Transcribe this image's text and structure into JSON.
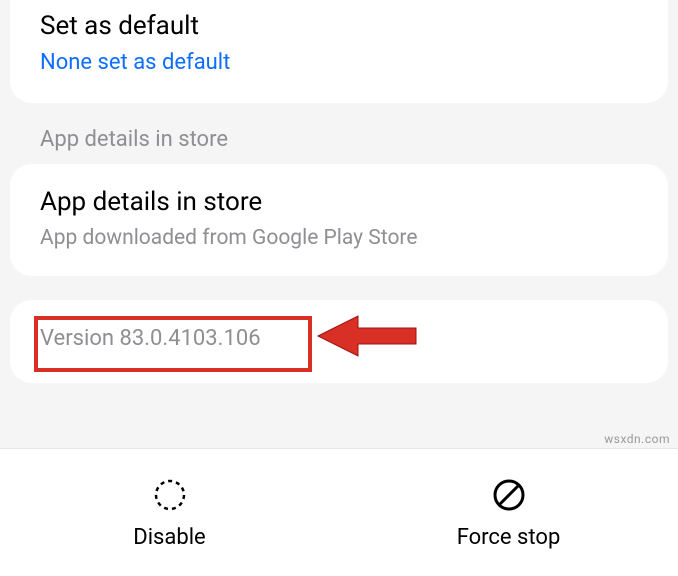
{
  "defaultSection": {
    "title": "Set as default",
    "subtitle": "None set as default"
  },
  "storeHeader": "App details in store",
  "storeSection": {
    "title": "App details in store",
    "subtitle": "App downloaded from Google Play Store"
  },
  "versionSection": {
    "text": "Version 83.0.4103.106"
  },
  "bottomBar": {
    "disable": "Disable",
    "forceStop": "Force stop"
  },
  "watermark": "wsxdn.com",
  "colors": {
    "highlight": "#d93025",
    "link": "#0d6efd"
  }
}
